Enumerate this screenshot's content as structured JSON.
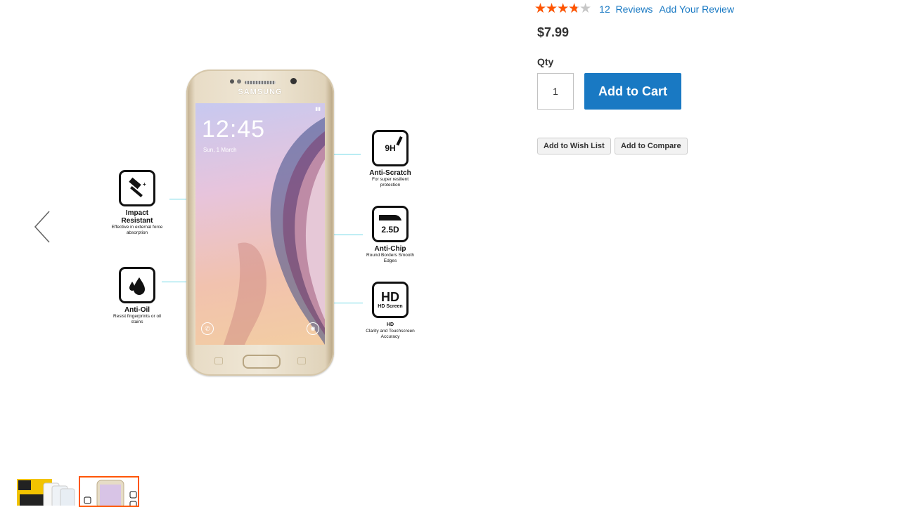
{
  "product": {
    "rating": {
      "stars": 3.8,
      "max": 5,
      "review_count": "12",
      "reviews_label": "Reviews",
      "add_review_label": "Add Your Review"
    },
    "price": "$7.99",
    "qty": {
      "label": "Qty",
      "value": "1"
    },
    "add_to_cart_label": "Add to Cart",
    "add_to_wishlist_label": "Add to Wish List",
    "add_to_compare_label": "Add to Compare"
  },
  "gallery": {
    "phone": {
      "brand": "SAMSUNG",
      "time": "12:45",
      "date": "Sun, 1 March"
    },
    "features": [
      {
        "icon": "hammer-icon",
        "title": "Impact Resistant",
        "subtitle": "Effective in external force absorption"
      },
      {
        "icon": "water-drop-icon",
        "title": "Anti-Oil",
        "subtitle": "Resist fingerprints or oil stains"
      },
      {
        "icon": "pencil-icon",
        "box_text": "9H",
        "title": "Anti-Scratch",
        "subtitle": "For super resilient protection"
      },
      {
        "icon": "rounded-edge-icon",
        "box_text": "2.5D",
        "title": "Anti-Chip",
        "subtitle": "Round Borders Smooth Edges"
      },
      {
        "icon": "hd-screen-icon",
        "box_text": "HD",
        "box_subtext": "HD Screen",
        "title": "HD",
        "subtitle": "Clarity and Touchscreen Accuracy"
      }
    ],
    "colors": {
      "accent": "#ff5501",
      "link": "#1979c3",
      "callout_line": "#6ed8e6"
    }
  }
}
